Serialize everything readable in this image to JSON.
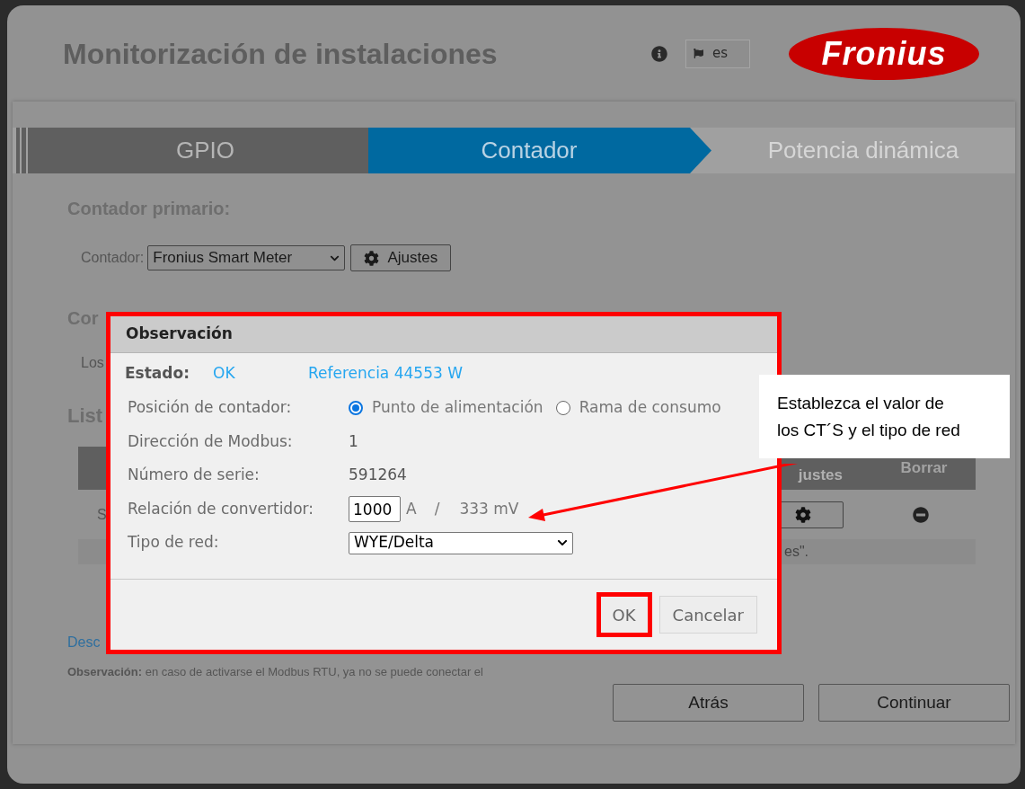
{
  "header": {
    "title": "Monitorización de instalaciones",
    "language": "es",
    "logo": "Fronius"
  },
  "steps": [
    {
      "label": "GPIO",
      "selected": false,
      "completed": true
    },
    {
      "label": "Contador",
      "selected": true
    },
    {
      "label": "Potencia dinámica",
      "selected": false,
      "completed": false
    }
  ],
  "primary_meter": {
    "heading": "Contador primario:",
    "field_label": "Contador:",
    "value": "Fronius Smart Meter",
    "button": "Ajustes"
  },
  "secondary_meter": {
    "heading_fragment": "Cor",
    "text_fragment": "Los"
  },
  "meter_list": {
    "heading_fragment": "List",
    "columns": [
      "justes",
      "Borrar"
    ],
    "row_fragment": "S",
    "note_fragment": "es\"."
  },
  "link_fragment": "Desc",
  "note": "**Observación:** en caso de activarse el Modbus RTU, ya no se puede conectar el",
  "footer_buttons": [
    "Atrás",
    "Continuar"
  ],
  "dialog": {
    "title": "Observación",
    "status_label": "Estado:",
    "status_value": "OK",
    "reference": "Referencia 44553 W",
    "rows": [
      {
        "kind": "radio",
        "label": "Posición de contador:",
        "options": [
          {
            "label": "Punto de alimentación",
            "selected": true
          },
          {
            "label": "Rama de consumo",
            "selected": false
          }
        ]
      },
      {
        "kind": "text",
        "label": "Dirección de Modbus:",
        "value": "1"
      },
      {
        "kind": "text",
        "label": "Número de serie:",
        "value": "591264"
      },
      {
        "kind": "ratio",
        "label": "Relación de convertidor:",
        "value": "1000",
        "unit": "A",
        "separator": "/",
        "reference": "333 mV"
      },
      {
        "kind": "select",
        "label": "Tipo de red:",
        "value": "WYE/Delta"
      }
    ],
    "buttons": [
      {
        "label": "OK",
        "highlighted": true
      },
      {
        "label": "Cancelar",
        "highlighted": false
      }
    ]
  },
  "callout": {
    "text": "Establezca el valor de los CT´S y el tipo de red"
  }
}
